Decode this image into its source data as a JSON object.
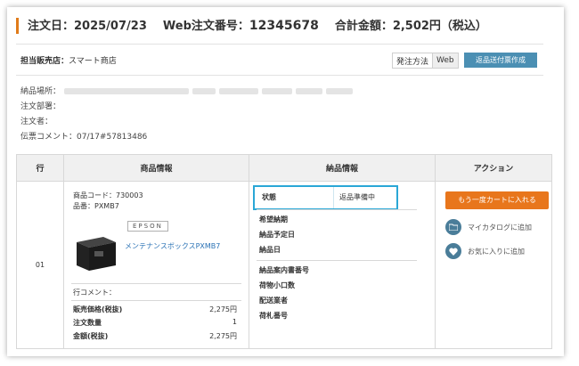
{
  "order": {
    "date_label": "注文日：2025/07/23",
    "web_no_label": "Web注文番号：",
    "web_no": "12345678",
    "total_label": "合計金額：2,502円（税込）"
  },
  "seller": {
    "label": "担当販売店：",
    "name": "スマート商店",
    "method_label": "発注方法",
    "method_value": "Web",
    "return_button": "返品送付票作成"
  },
  "info": {
    "delivery_place": "納品場所：",
    "dept": "注文部署：",
    "orderer": "注文者：",
    "comment": "伝票コメント：07/17#57813486"
  },
  "table": {
    "headers": [
      "行",
      "商品情報",
      "納品情報",
      "アクション"
    ],
    "row_no": "01",
    "product": {
      "code": "商品コード：730003",
      "part": "品番：PXMB7",
      "brand": "EPSON",
      "name": "メンテナンスボックスPXMB7",
      "line_comment": "行コメント：",
      "price_label": "販売価格(税抜)",
      "price_value": "2,275円",
      "qty_label": "注文数量",
      "qty_value": "1",
      "amount_label": "金額(税抜)",
      "amount_value": "2,275円"
    },
    "delivery": {
      "status_label": "状態",
      "status_value": "返品準備中",
      "desired": "希望納期",
      "planned": "納品予定日",
      "delivered": "納品日",
      "slip_no": "納品案内書番号",
      "pieces": "荷物小口数",
      "carrier": "配送業者",
      "tracking": "荷札番号"
    },
    "actions": {
      "cart_button": "もう一度カートに入れる",
      "catalog": "マイカタログに追加",
      "favorite": "お気に入りに追加"
    }
  },
  "colors": {
    "accent": "#e07b1a",
    "cart_button": "#e8761c",
    "return_button": "#4b8fb3",
    "highlight": "#2aa7d6",
    "link": "#2a72b5"
  }
}
